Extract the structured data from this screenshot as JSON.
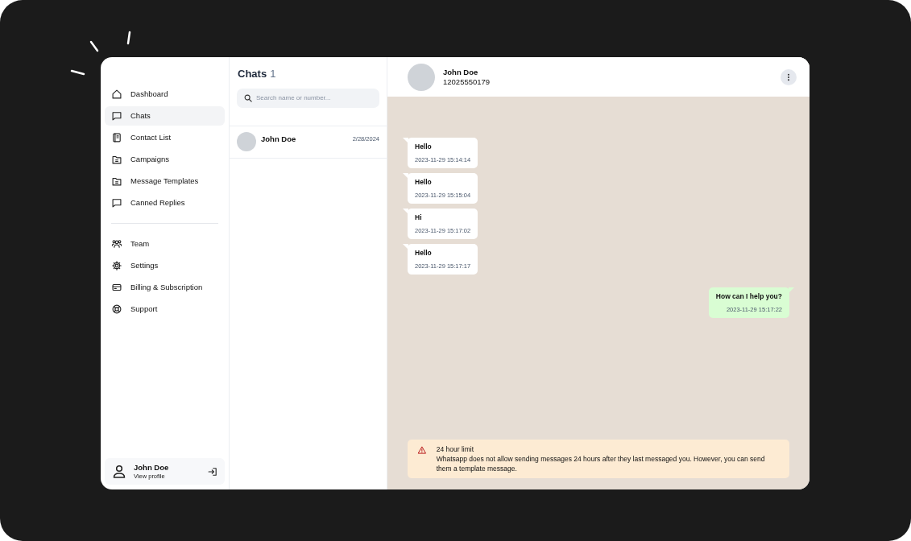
{
  "sidebar": {
    "groups": [
      [
        {
          "label": "Dashboard",
          "selected": false
        },
        {
          "label": "Chats",
          "selected": true
        },
        {
          "label": "Contact List",
          "selected": false
        },
        {
          "label": "Campaigns",
          "selected": false
        },
        {
          "label": "Message Templates",
          "selected": false
        },
        {
          "label": "Canned Replies",
          "selected": false
        }
      ],
      [
        {
          "label": "Team",
          "selected": false
        },
        {
          "label": "Settings",
          "selected": false
        },
        {
          "label": "Billing & Subscription",
          "selected": false
        },
        {
          "label": "Support",
          "selected": false
        }
      ]
    ],
    "profile": {
      "name": "John Doe",
      "link": "View profile"
    }
  },
  "chat_list": {
    "title": "Chats",
    "count": "1",
    "search": {
      "placeholder": "Search name or number..."
    },
    "chats": [
      {
        "name": "John Doe",
        "date": "2/28/2024",
        "selected": false
      }
    ]
  },
  "conversation": {
    "contact": {
      "name": "John Doe",
      "phone": "12025550179"
    },
    "messages": [
      {
        "kind": "incoming",
        "text": "Hello",
        "time": "2023-11-29 15:14:14"
      },
      {
        "kind": "incoming",
        "text": "Hello",
        "time": "2023-11-29 15:15:04"
      },
      {
        "kind": "incoming",
        "text": "Hi",
        "time": "2023-11-29 15:17:02"
      },
      {
        "kind": "incoming",
        "text": "Hello",
        "time": "2023-11-29 15:17:17"
      },
      {
        "kind": "outgoing",
        "text": "How can I help you?",
        "time": "2023-11-29 15:17:22"
      }
    ],
    "notice": {
      "title": "24 hour limit",
      "text": "Whatsapp does not allow sending messages 24 hours after they last messaged you. However, you can send them a template message."
    }
  }
}
